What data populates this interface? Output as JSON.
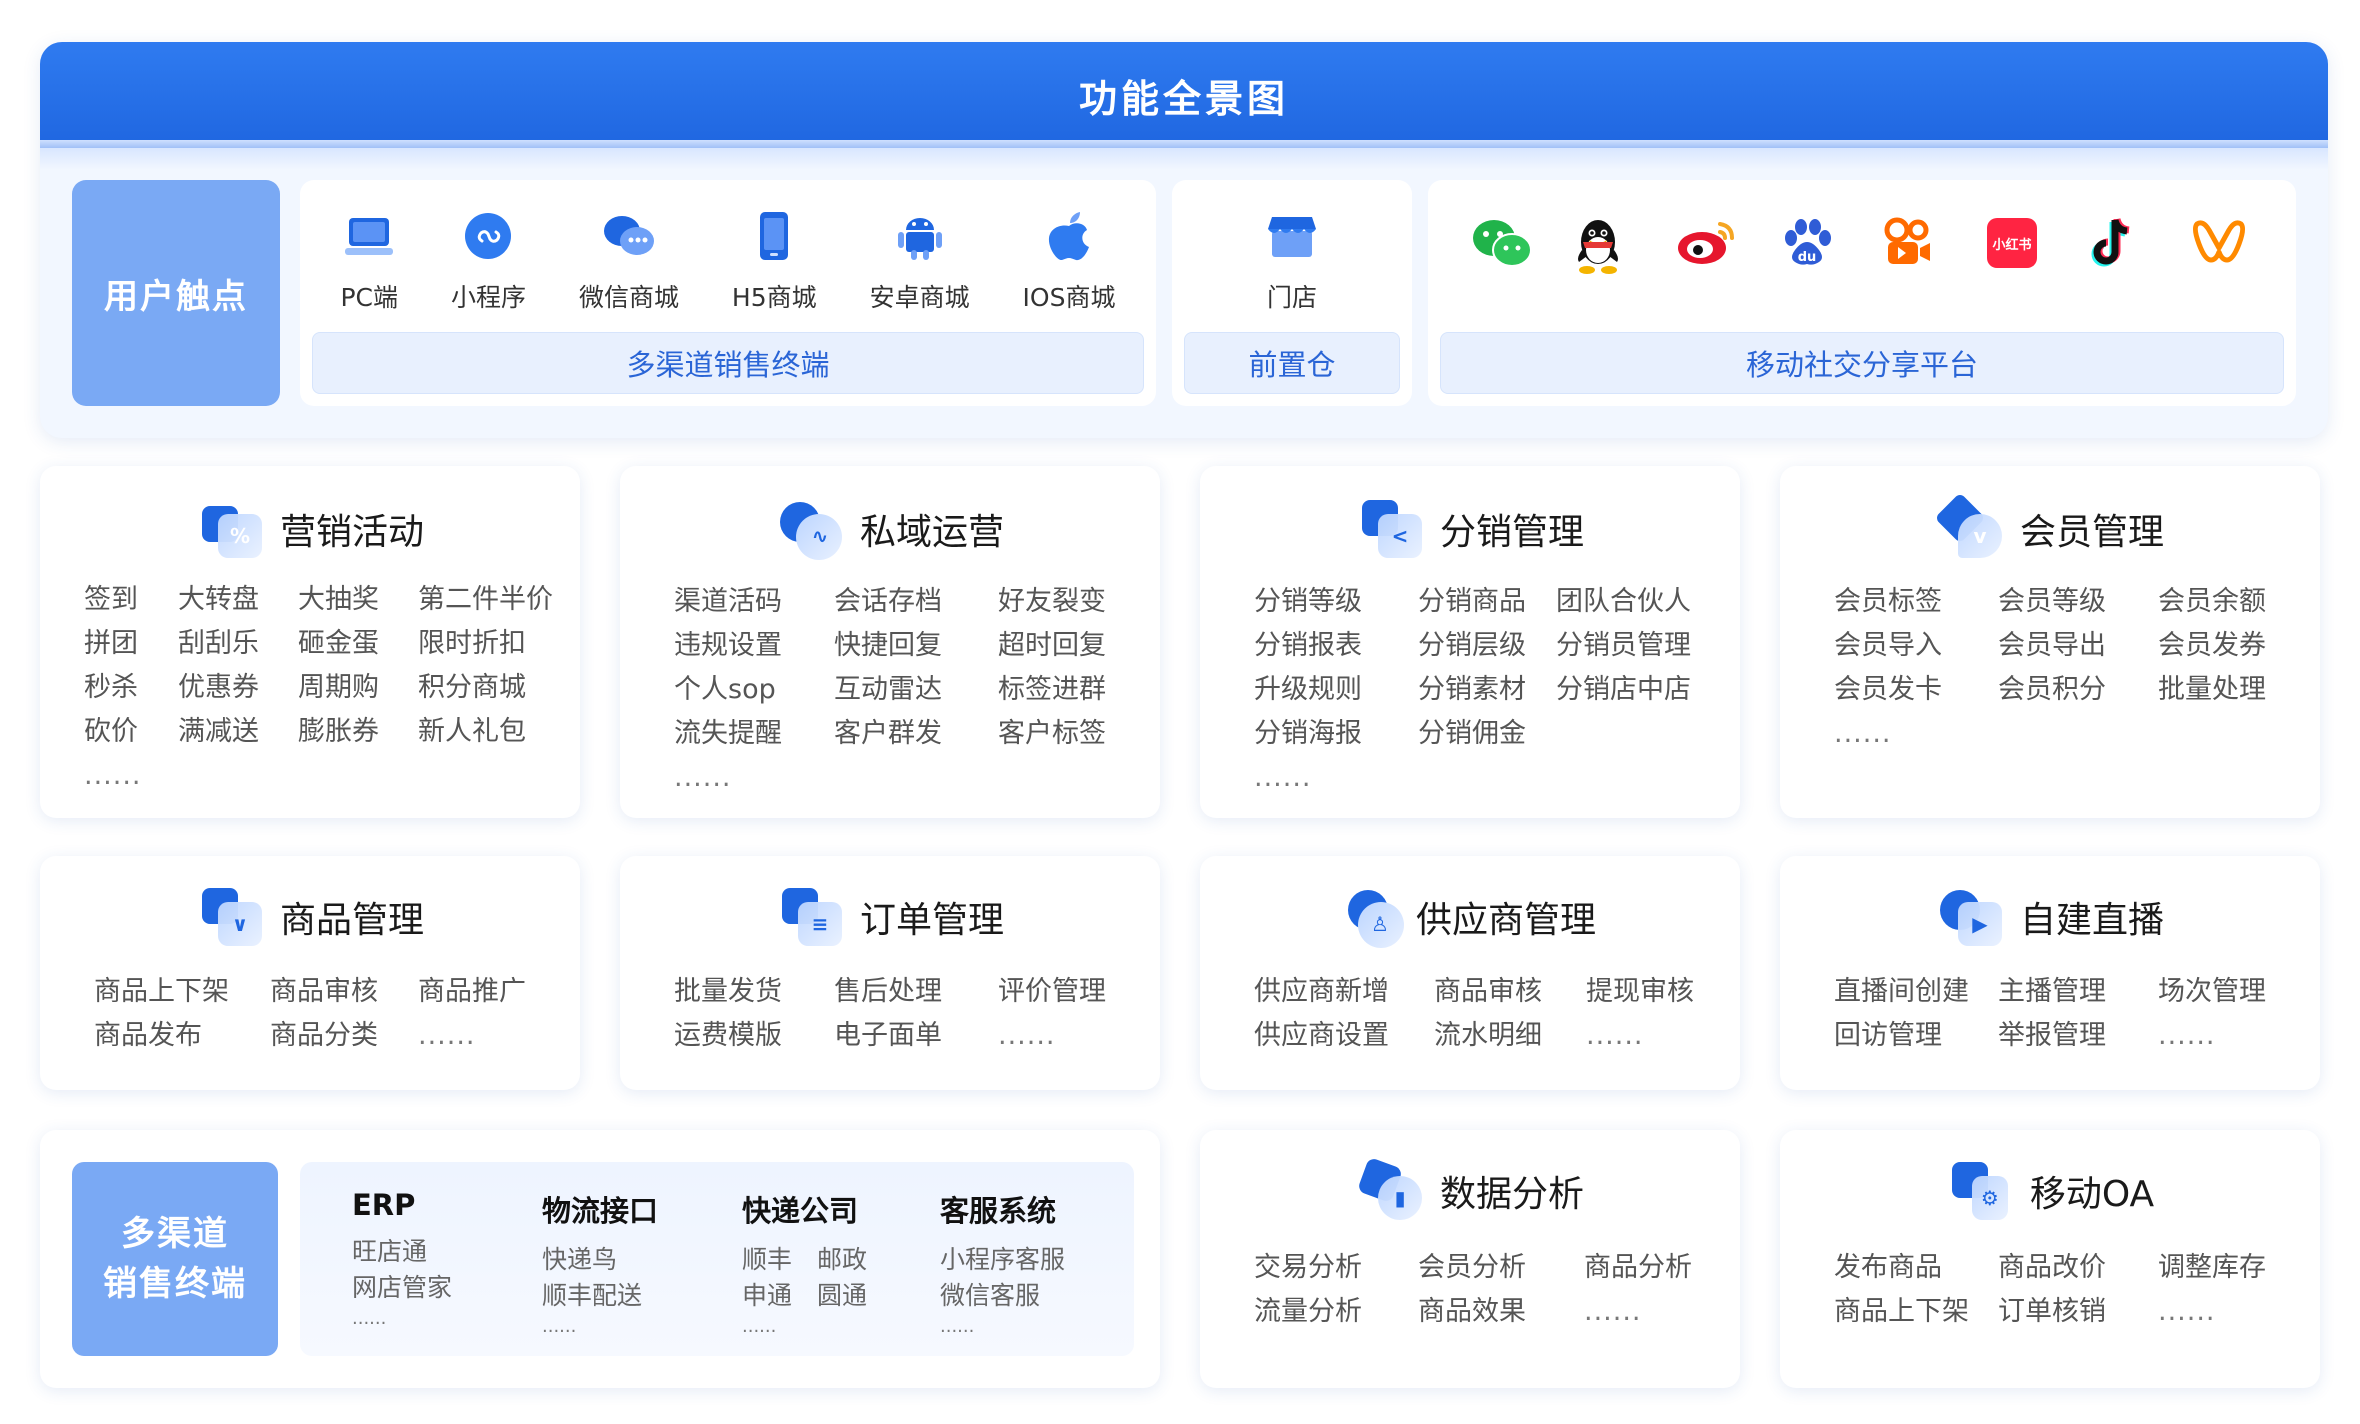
{
  "header": {
    "title": "功能全景图"
  },
  "touch": {
    "label": "用户触点",
    "terminals": {
      "items": [
        {
          "label": "PC端",
          "icon": "laptop-icon"
        },
        {
          "label": "小程序",
          "icon": "mini-program-icon"
        },
        {
          "label": "微信商城",
          "icon": "wechat-mall-icon"
        },
        {
          "label": "H5商城",
          "icon": "mobile-phone-icon"
        },
        {
          "label": "安卓商城",
          "icon": "android-icon"
        },
        {
          "label": "IOS商城",
          "icon": "apple-icon"
        }
      ],
      "footer": "多渠道销售终端"
    },
    "store": {
      "item": "门店",
      "icon": "store-icon",
      "footer": "前置仓"
    },
    "social": {
      "icons": [
        "wechat-icon",
        "qq-icon",
        "weibo-icon",
        "baidu-icon",
        "kuaishou-icon",
        "xiaohongshu-icon",
        "douyin-icon",
        "app-logo-icon"
      ],
      "xiaohongshu_text": "小红书",
      "footer": "移动社交分享平台"
    }
  },
  "cards": {
    "marketing": {
      "title": "营销活动",
      "items": [
        "签到",
        "大转盘",
        "大抽奖",
        "第二件半价",
        "拼团",
        "刮刮乐",
        "砸金蛋",
        "限时折扣",
        "秒杀",
        "优惠券",
        "周期购",
        "积分商城",
        "砍价",
        "满减送",
        "膨胀券",
        "新人礼包",
        "......"
      ]
    },
    "private": {
      "title": "私域运营",
      "items": [
        "渠道活码",
        "会话存档",
        "好友裂变",
        "违规设置",
        "快捷回复",
        "超时回复",
        "个人sop",
        "互动雷达",
        "标签进群",
        "流失提醒",
        "客户群发",
        "客户标签",
        "......"
      ]
    },
    "distribution": {
      "title": "分销管理",
      "items": [
        "分销等级",
        "分销商品",
        "团队合伙人",
        "分销报表",
        "分销层级",
        "分销员管理",
        "升级规则",
        "分销素材",
        "分销店中店",
        "分销海报",
        "分销佣金",
        "",
        "......"
      ]
    },
    "member": {
      "title": "会员管理",
      "items": [
        "会员标签",
        "会员等级",
        "会员余额",
        "会员导入",
        "会员导出",
        "会员发券",
        "会员发卡",
        "会员积分",
        "批量处理",
        "......"
      ]
    },
    "goods": {
      "title": "商品管理",
      "items": [
        "商品上下架",
        "商品审核",
        "商品推广",
        "商品发布",
        "商品分类",
        "......"
      ]
    },
    "order": {
      "title": "订单管理",
      "items": [
        "批量发货",
        "售后处理",
        "评价管理",
        "运费模版",
        "电子面单",
        "......"
      ]
    },
    "supplier": {
      "title": "供应商管理",
      "items": [
        "供应商新增",
        "商品审核",
        "提现审核",
        "供应商设置",
        "流水明细",
        "......"
      ]
    },
    "live": {
      "title": "自建直播",
      "items": [
        "直播间创建",
        "主播管理",
        "场次管理",
        "回访管理",
        "举报管理",
        "......"
      ]
    },
    "data": {
      "title": "数据分析",
      "items": [
        "交易分析",
        "会员分析",
        "商品分析",
        "流量分析",
        "商品效果",
        "......"
      ]
    },
    "oa": {
      "title": "移动OA",
      "items": [
        "发布商品",
        "商品改价",
        "调整库存",
        "商品上下架",
        "订单核销",
        "......"
      ]
    }
  },
  "multichannel": {
    "label_line1": "多渠道",
    "label_line2": "销售终端",
    "columns": [
      {
        "head": "ERP",
        "lines": [
          "旺店通",
          "网店管家"
        ],
        "more": "......"
      },
      {
        "head": "物流接口",
        "lines": [
          "快递鸟",
          "顺丰配送"
        ],
        "more": "......"
      },
      {
        "head": "快递公司",
        "lines": [
          "顺丰　邮政",
          "申通　圆通"
        ],
        "more": "......"
      },
      {
        "head": "客服系统",
        "lines": [
          "小程序客服",
          "微信客服"
        ],
        "more": "......"
      }
    ]
  },
  "colors": {
    "primary": "#1f66e0",
    "header_bg": "#2f7bf0",
    "label_bg": "#7aa9f4",
    "panel_bg": "#f2f7ff",
    "footer_text": "#2a65d6"
  }
}
